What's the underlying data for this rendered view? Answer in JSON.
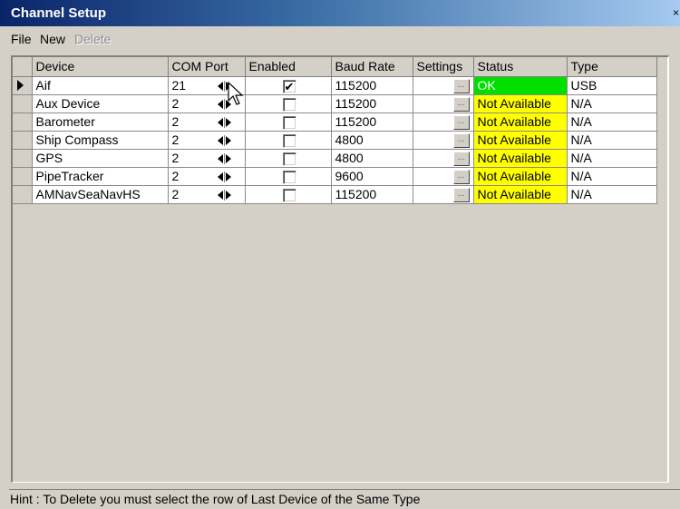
{
  "window": {
    "title": "Channel Setup",
    "close_glyph": "×"
  },
  "menu": {
    "file": "File",
    "new": "New",
    "delete": "Delete"
  },
  "grid": {
    "columns": [
      "Device",
      "COM Port",
      "Enabled",
      "Baud Rate",
      "Settings",
      "Status",
      "Type"
    ],
    "rows": [
      {
        "device": "Aif",
        "com_port": "21",
        "enabled": true,
        "baud_rate": "115200",
        "settings": "...",
        "status": "OK",
        "status_kind": "ok",
        "type": "USB",
        "current": true
      },
      {
        "device": "Aux Device",
        "com_port": "2",
        "enabled": false,
        "baud_rate": "115200",
        "settings": "...",
        "status": "Not Available",
        "status_kind": "na",
        "type": "N/A"
      },
      {
        "device": "Barometer",
        "com_port": "2",
        "enabled": false,
        "baud_rate": "115200",
        "settings": "...",
        "status": "Not Available",
        "status_kind": "na",
        "type": "N/A"
      },
      {
        "device": "Ship Compass",
        "com_port": "2",
        "enabled": false,
        "baud_rate": "4800",
        "settings": "...",
        "status": "Not Available",
        "status_kind": "na",
        "type": "N/A"
      },
      {
        "device": "GPS",
        "com_port": "2",
        "enabled": false,
        "baud_rate": "4800",
        "settings": "...",
        "status": "Not Available",
        "status_kind": "na",
        "type": "N/A"
      },
      {
        "device": "PipeTracker",
        "com_port": "2",
        "enabled": false,
        "baud_rate": "9600",
        "settings": "...",
        "status": "Not Available",
        "status_kind": "na",
        "type": "N/A"
      },
      {
        "device": "AMNavSeaNavHS",
        "com_port": "2",
        "enabled": false,
        "baud_rate": "115200",
        "settings": "...",
        "status": "Not Available",
        "status_kind": "na",
        "type": "N/A"
      }
    ]
  },
  "colors": {
    "status_ok": "#00e000",
    "status_na": "#ffff00",
    "title_gradient_start": "#0a246a"
  },
  "hint": "Hint : To Delete you must select the row of Last Device of the Same Type"
}
